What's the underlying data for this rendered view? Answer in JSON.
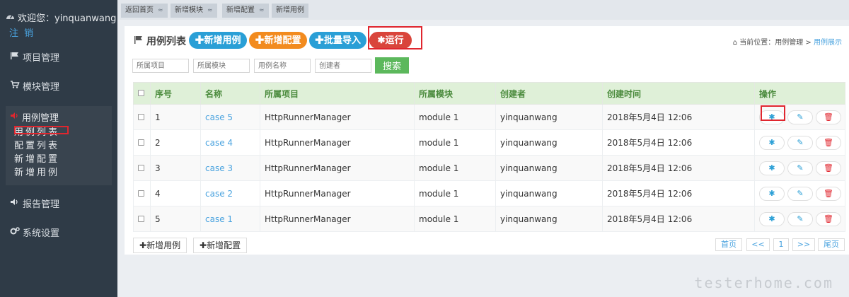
{
  "sidebar": {
    "welcome": "欢迎您：yinquanwang",
    "logout": "注 销",
    "items": [
      {
        "label": "项目管理"
      },
      {
        "label": "模块管理"
      },
      {
        "label": "用例管理"
      },
      {
        "label": "报告管理"
      },
      {
        "label": "系统设置"
      }
    ],
    "sub_items": [
      {
        "label": "用例列表"
      },
      {
        "label": "配置列表"
      },
      {
        "label": "新增配置"
      },
      {
        "label": "新增用例"
      }
    ]
  },
  "top_tabs": [
    {
      "label": "返回首页"
    },
    {
      "label": "新增模块"
    },
    {
      "label": "新增配置"
    },
    {
      "label": "新增用例"
    }
  ],
  "panel": {
    "title": "用例列表",
    "buttons": {
      "add_case": "✚新增用例",
      "add_config": "✚新增配置",
      "batch_import": "✚批量导入",
      "run": "运行"
    },
    "breadcrumb": {
      "prefix": "当前位置：",
      "parent": "用例管理",
      "sep": " > ",
      "current": "用例展示"
    },
    "filters": {
      "project": "所属项目",
      "module": "所属模块",
      "case_name": "用例名称",
      "creator": "创建者",
      "search": "搜索"
    }
  },
  "table": {
    "headers": [
      "序号",
      "名称",
      "所属项目",
      "所属模块",
      "创建者",
      "创建时间",
      "操作"
    ],
    "rows": [
      {
        "no": "1",
        "name": "case 5",
        "project": "HttpRunnerManager",
        "module": "module 1",
        "creator": "yinquanwang",
        "time": "2018年5月4日 12:06"
      },
      {
        "no": "2",
        "name": "case 4",
        "project": "HttpRunnerManager",
        "module": "module 1",
        "creator": "yinquanwang",
        "time": "2018年5月4日 12:06"
      },
      {
        "no": "3",
        "name": "case 3",
        "project": "HttpRunnerManager",
        "module": "module 1",
        "creator": "yinquanwang",
        "time": "2018年5月4日 12:06"
      },
      {
        "no": "4",
        "name": "case 2",
        "project": "HttpRunnerManager",
        "module": "module 1",
        "creator": "yinquanwang",
        "time": "2018年5月4日 12:06"
      },
      {
        "no": "5",
        "name": "case 1",
        "project": "HttpRunnerManager",
        "module": "module 1",
        "creator": "yinquanwang",
        "time": "2018年5月4日 12:06"
      }
    ]
  },
  "footer": {
    "add_case": "新增用例",
    "add_config": "新增配置",
    "pagination": {
      "first": "首页",
      "prev": "<<",
      "current": "1",
      "next": ">>",
      "last": "尾页"
    }
  },
  "watermark": "testerhome.com",
  "colors": {
    "sidebar_bg": "#2f3b47",
    "accent_blue": "#2a9fd6",
    "accent_orange": "#f28b1f",
    "run_red": "#d9453b",
    "search_green": "#5cb85c",
    "highlight_red": "#e0262e"
  }
}
